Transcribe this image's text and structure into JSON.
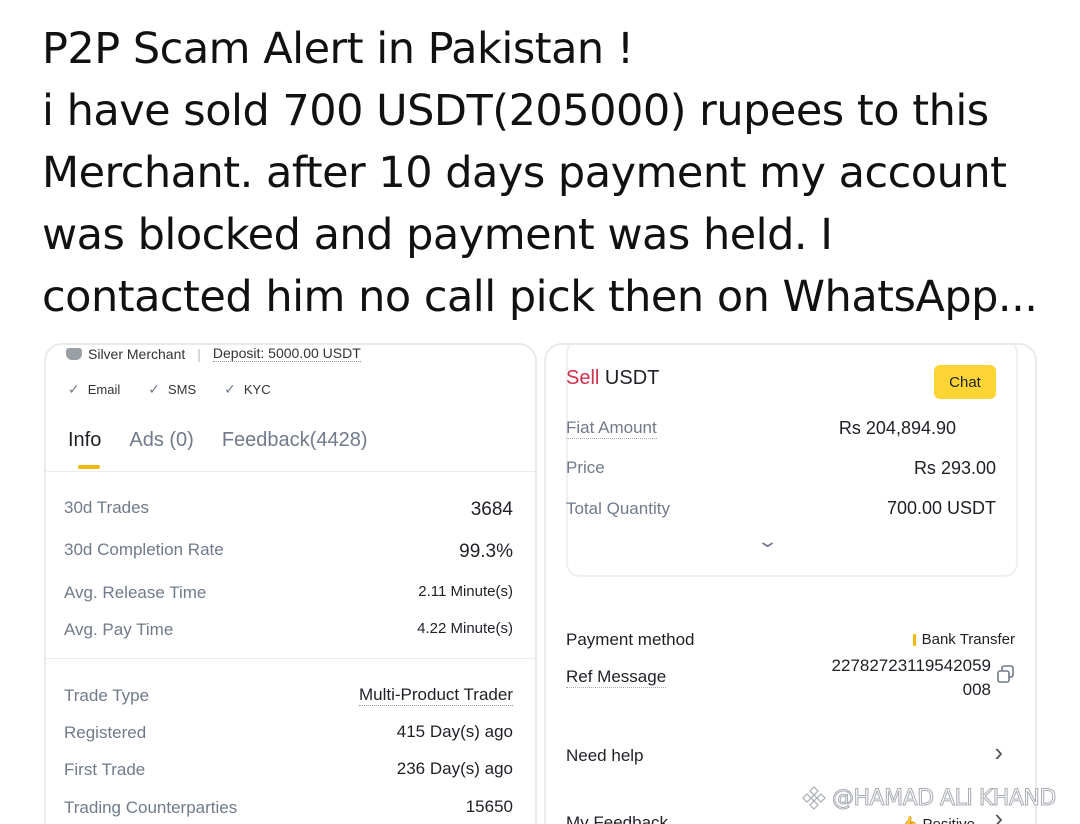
{
  "headline": {
    "lines": [
      "P2P Scam Alert in Pakistan !",
      "i have sold 700 USDT(205000) rupees to this",
      "Merchant. after 10 days  payment my account",
      "was blocked and payment was held. I",
      "contacted him no call pick then on WhatsApp..."
    ]
  },
  "merchant": {
    "badge": "Silver Merchant",
    "deposit": "Deposit: 5000.00 USDT",
    "verifications": [
      "Email",
      "SMS",
      "KYC"
    ],
    "tabs": [
      "Info",
      "Ads (0)",
      "Feedback(4428)"
    ],
    "active_tab": "Info",
    "stats": [
      {
        "label": "30d Trades",
        "value": "3684"
      },
      {
        "label": "30d Completion Rate",
        "value": "99.3%"
      },
      {
        "label": "Avg. Release Time",
        "value": "2.11 Minute(s)"
      },
      {
        "label": "Avg. Pay Time",
        "value": "4.22 Minute(s)"
      }
    ],
    "details": [
      {
        "label": "Trade Type",
        "value": "Multi-Product Trader"
      },
      {
        "label": "Registered",
        "value": "415 Day(s) ago"
      },
      {
        "label": "First Trade",
        "value": "236 Day(s) ago"
      },
      {
        "label": "Trading Counterparties",
        "value": "15650"
      }
    ]
  },
  "order": {
    "side": "Sell",
    "asset": "USDT",
    "chat_label": "Chat",
    "rows": [
      {
        "label": "Fiat Amount",
        "value": "Rs 204,894.90"
      },
      {
        "label": "Price",
        "value": "Rs 293.00"
      },
      {
        "label": "Total Quantity",
        "value": "700.00 USDT"
      }
    ],
    "payment_method_label": "Payment method",
    "payment_method_value": "Bank Transfer",
    "ref_label": "Ref Message",
    "ref_value_1": "22782723119542059",
    "ref_value_2": "008",
    "need_help": "Need help",
    "my_feedback": "My Feedback",
    "feedback_value": "Positive"
  },
  "watermark": "@HAMAD ALI KHAND",
  "colors": {
    "sell": "#cf304a",
    "accent": "#fcd535",
    "muted": "#707a8a"
  }
}
